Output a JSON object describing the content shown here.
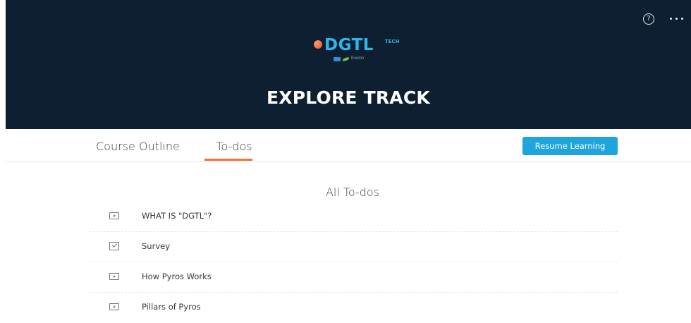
{
  "header": {
    "logo_word": "DGTL",
    "logo_superscript": "TECH",
    "logo_sub": "Exelon",
    "title": "EXPLORE TRACK",
    "help_icon": "?"
  },
  "tabs": {
    "course_outline": "Course Outline",
    "todos": "To-dos",
    "active": "To-dos"
  },
  "resume_button": "Resume Learning",
  "list": {
    "title": "All To-dos",
    "items": [
      {
        "label": "WHAT IS \"DGTL\"?",
        "icon": "video-icon"
      },
      {
        "label": "Survey",
        "icon": "survey-icon"
      },
      {
        "label": "How Pyros Works",
        "icon": "video-icon"
      },
      {
        "label": "Pillars of Pyros",
        "icon": "video-icon"
      }
    ]
  },
  "colors": {
    "header_bg": "#0d1f30",
    "accent_orange": "#f2723a",
    "button_blue": "#1ea5dc",
    "logo_blue": "#2fb5e8"
  }
}
